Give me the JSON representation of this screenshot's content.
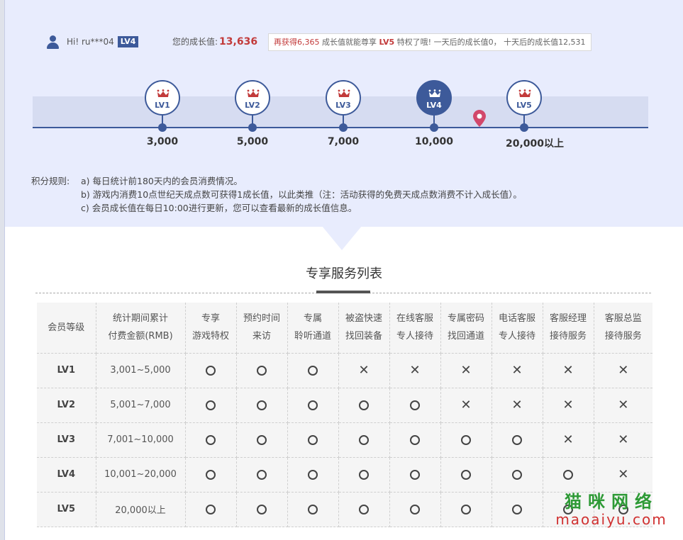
{
  "user": {
    "greeting": "Hi!  ru***04",
    "level_badge": "LV4",
    "icon": "user-icon"
  },
  "growth": {
    "label": "您的成长值:",
    "value": "13,636",
    "tip_prefix": "再获得6,365",
    "tip_mid": " 成长值就能尊享 ",
    "tip_level": "LV5",
    "tip_suffix": " 特权了哦!  一天后的成长值0，  十天后的成长值12,531"
  },
  "levels": [
    {
      "label": "LV1",
      "threshold": "3,000",
      "active": false
    },
    {
      "label": "LV2",
      "threshold": "5,000",
      "active": false
    },
    {
      "label": "LV3",
      "threshold": "7,000",
      "active": false
    },
    {
      "label": "LV4",
      "threshold": "10,000",
      "active": true
    },
    {
      "label": "LV5",
      "threshold": "20,000以上",
      "active": false
    }
  ],
  "rules": {
    "title": "积分规则:",
    "lines": [
      "a) 每日统计前180天内的会员消费情况。",
      "b) 游戏内消费10点世纪天成点数可获得1成长值，以此类推（注：活动获得的免费天成点数消费不计入成长值）。",
      "c) 会员成长值在每日10:00进行更新，您可以查看最新的成长值信息。"
    ]
  },
  "services": {
    "title": "专享服务列表",
    "headers": [
      [
        "会员等级"
      ],
      [
        "统计期间累计",
        "付费金额(RMB)"
      ],
      [
        "专享",
        "游戏特权"
      ],
      [
        "预约时间",
        "来访"
      ],
      [
        "专属",
        "聆听通道"
      ],
      [
        "被盗快速",
        "找回装备"
      ],
      [
        "在线客服",
        "专人接待"
      ],
      [
        "专属密码",
        "找回通道"
      ],
      [
        "电话客服",
        "专人接待"
      ],
      [
        "客服经理",
        "接待服务"
      ],
      [
        "客服总监",
        "接待服务"
      ]
    ],
    "rows": [
      {
        "level": "LV1",
        "amount": "3,001~5,000",
        "marks": [
          1,
          1,
          1,
          0,
          0,
          0,
          0,
          0,
          0
        ]
      },
      {
        "level": "LV2",
        "amount": "5,001~7,000",
        "marks": [
          1,
          1,
          1,
          1,
          1,
          0,
          0,
          0,
          0
        ]
      },
      {
        "level": "LV3",
        "amount": "7,001~10,000",
        "marks": [
          1,
          1,
          1,
          1,
          1,
          1,
          1,
          0,
          0
        ]
      },
      {
        "level": "LV4",
        "amount": "10,001~20,000",
        "marks": [
          1,
          1,
          1,
          1,
          1,
          1,
          1,
          1,
          0
        ]
      },
      {
        "level": "LV5",
        "amount": "20,000以上",
        "marks": [
          1,
          1,
          1,
          1,
          1,
          1,
          1,
          1,
          1
        ]
      }
    ]
  },
  "watermark": {
    "cn": "猫咪网络",
    "en": "maoaiyu.com"
  },
  "colors": {
    "primary": "#3d5a9a",
    "accent_red": "#c23a3a",
    "panel_bg": "#e8ecfd"
  }
}
